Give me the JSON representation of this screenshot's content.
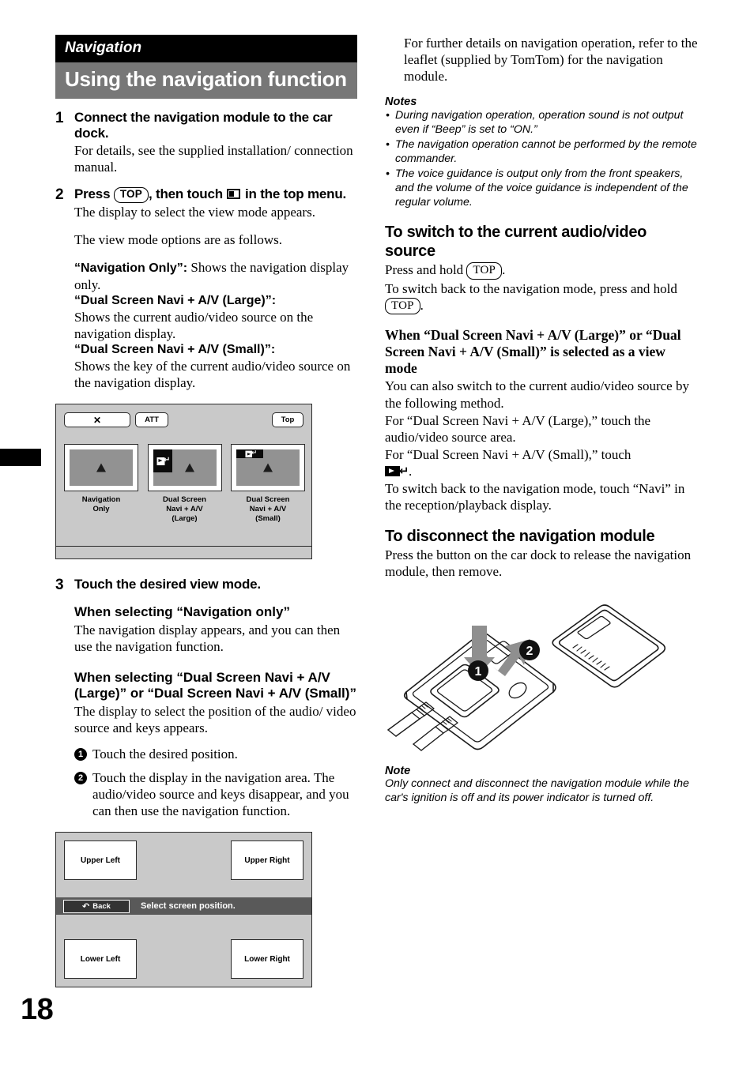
{
  "page": {
    "number": "18"
  },
  "left": {
    "section_label": "Navigation",
    "chapter_title": "Using the navigation function",
    "step1": {
      "num": "1",
      "title": "Connect the navigation module to the car dock.",
      "body": "For details, see the supplied installation/ connection manual."
    },
    "step2": {
      "num": "2",
      "title_pre": "Press",
      "title_key": "TOP",
      "title_mid": ", then touch",
      "title_post": "in the top menu.",
      "body1": "The display to select the view mode appears.",
      "body2": "The view mode options are as follows.",
      "mode1_name": "“Navigation Only”:",
      "mode1_desc": " Shows the navigation display only.",
      "mode2_name": "“Dual Screen Navi + A/V (Large)”:",
      "mode2_desc": "Shows the current audio/video source on the navigation display.",
      "mode3_name": "“Dual Screen Navi + A/V (Small)”:",
      "mode3_desc": "Shows the key of the current audio/video source on the navigation display."
    },
    "screen_viewmode": {
      "close_label": "✕",
      "att_label": "ATT",
      "top_label": "Top",
      "modes": [
        {
          "label": "Navigation\nOnly"
        },
        {
          "label": "Dual Screen\nNavi + A/V\n(Large)"
        },
        {
          "label": "Dual Screen\nNavi + A/V\n(Small)"
        }
      ]
    },
    "step3": {
      "num": "3",
      "title": "Touch the desired view mode.",
      "h1": "When selecting “Navigation only”",
      "h1_body": "The navigation display appears, and you can then use the navigation function.",
      "h2": "When selecting “Dual Screen Navi + A/V (Large)” or “Dual Screen Navi + A/V (Small)”",
      "h2_body": "The display to select the position of the audio/ video source and keys appears.",
      "items": [
        {
          "num": "1",
          "text": "Touch the desired position."
        },
        {
          "num": "2",
          "text": "Touch the display in the navigation area. The audio/video source and keys disappear, and you can then use the navigation function."
        }
      ]
    },
    "screen_position": {
      "upper_left": "Upper Left",
      "upper_right": "Upper Right",
      "lower_left": "Lower Left",
      "lower_right": "Lower Right",
      "back_label": "Back",
      "back_icon": "↶",
      "status_text": "Select screen position."
    }
  },
  "right": {
    "intro": "For further details on navigation operation, refer to the leaflet (supplied by TomTom) for the navigation module.",
    "notes_title": "Notes",
    "notes": [
      "During navigation operation, operation sound is not output even if “Beep” is set to “ON.”",
      "The navigation operation cannot be performed by the remote commander.",
      "The voice guidance is output only from the front speakers, and the volume of the voice guidance is independent of the regular volume."
    ],
    "switch_heading": "To switch to the current audio/video source",
    "switch_line1_pre": "Press and hold",
    "switch_key": "TOP",
    "switch_line1_post": ".",
    "switch_line2_pre": "To switch back to the navigation mode, press and hold",
    "switch_line2_post": ".",
    "dual_heading": "When “Dual Screen Navi + A/V (Large)” or “Dual Screen Navi + A/V (Small)” is selected as a view mode",
    "dual_body1": "You can also switch to the current audio/video source by the following method.",
    "dual_body2": "For “Dual Screen Navi + A/V (Large),” touch the audio/video source area.",
    "dual_body3_pre": "For “Dual Screen Navi + A/V (Small),” touch",
    "dual_body3_post": ".",
    "dual_body4": "To switch back to the navigation mode, touch “Navi” in the reception/playback display.",
    "disconnect_heading": "To disconnect the navigation module",
    "disconnect_body": "Press the button on the car dock to release the navigation module, then remove.",
    "illustration": {
      "callout_1": "1",
      "callout_2": "2"
    },
    "note_title": "Note",
    "note_body": "Only connect and disconnect the navigation module while the car's ignition is off and its power indicator is turned off."
  },
  "colors": {
    "header_black": "#000000",
    "header_gray": "#777777",
    "screen_bg": "#c9c9c9",
    "screen_panel": "#929292",
    "status_bar": "#595959"
  }
}
